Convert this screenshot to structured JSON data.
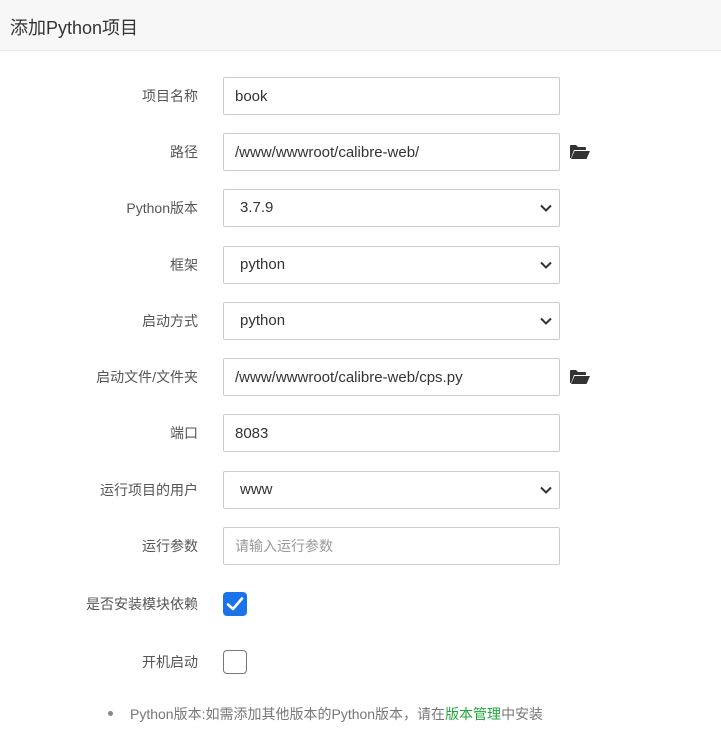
{
  "dialog": {
    "title": "添加Python项目"
  },
  "form": {
    "project_name": {
      "label": "项目名称",
      "value": "book"
    },
    "path": {
      "label": "路径",
      "value": "/www/wwwroot/calibre-web/"
    },
    "python_version": {
      "label": "Python版本",
      "value": "3.7.9"
    },
    "framework": {
      "label": "框架",
      "value": "python"
    },
    "startup_mode": {
      "label": "启动方式",
      "value": "python"
    },
    "startup_file": {
      "label": "启动文件/文件夹",
      "value": "/www/wwwroot/calibre-web/cps.py"
    },
    "port": {
      "label": "端口",
      "value": "8083"
    },
    "run_user": {
      "label": "运行项目的用户",
      "value": "www"
    },
    "run_args": {
      "label": "运行参数",
      "value": "",
      "placeholder": "请输入运行参数"
    },
    "install_deps": {
      "label": "是否安装模块依赖",
      "checked": true
    },
    "autostart": {
      "label": "开机启动",
      "checked": false
    }
  },
  "tip": {
    "prefix": "Python版本:如需添加其他版本的Python版本，请在",
    "link": "版本管理",
    "suffix": "中安装"
  },
  "colors": {
    "accent": "#1a73e8",
    "link": "#20a53a"
  },
  "icons": {
    "folder": "folder-open-icon",
    "chevron": "chevron-down-icon",
    "check": "checkmark-icon"
  }
}
